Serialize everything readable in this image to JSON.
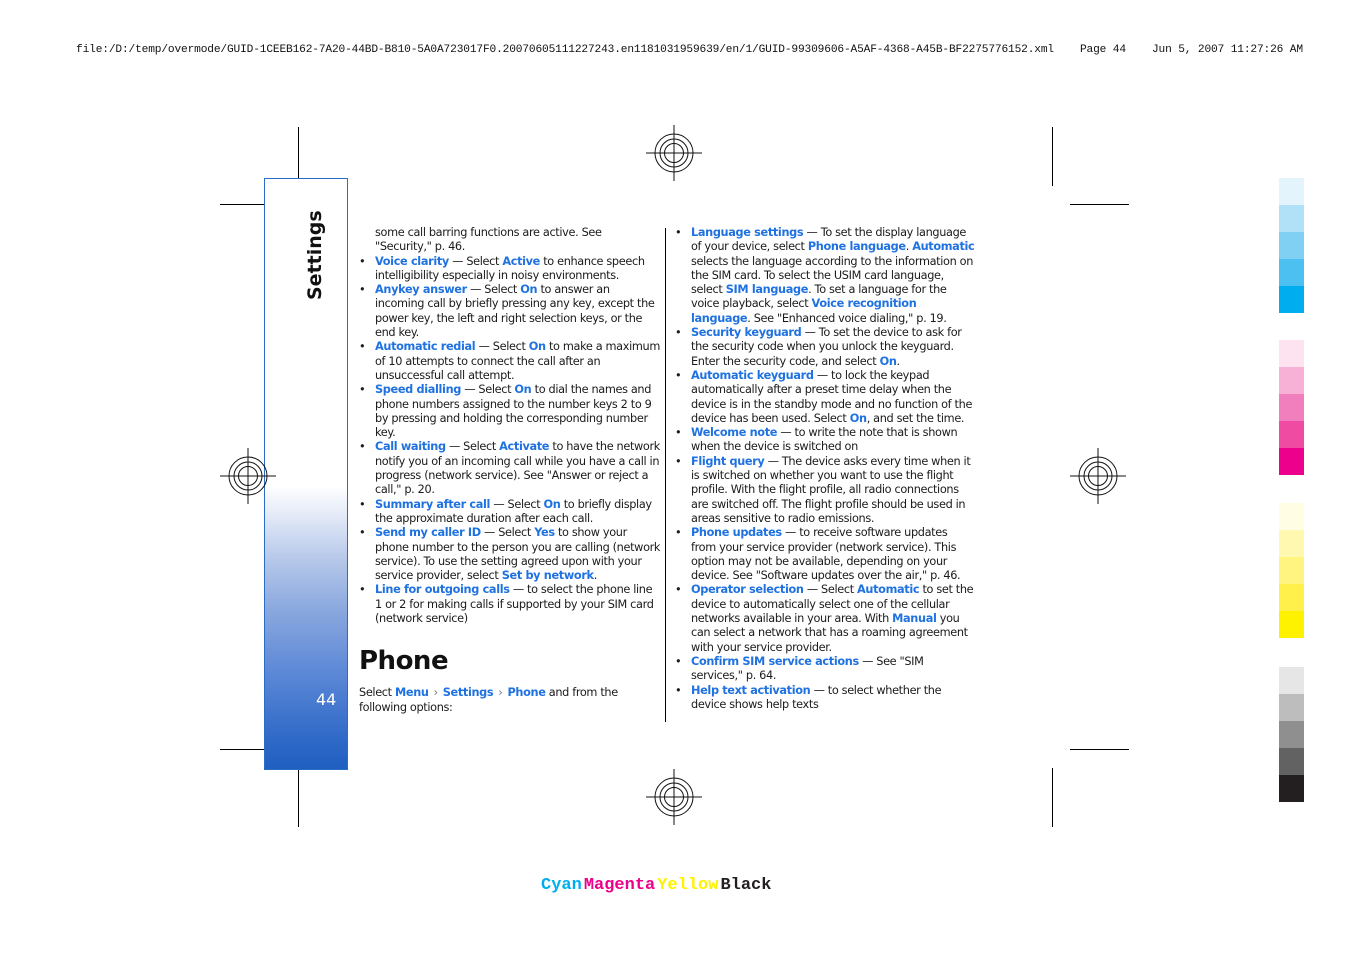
{
  "header": {
    "file_path": "file:/D:/temp/overmode/GUID-1CEEB162-7A20-44BD-B810-5A0A723017F0.20070605111227243.en1181031959639/en/1/GUID-99309606-A5AF-4368-A45B-BF2275776152.xml",
    "page_label": "Page 44",
    "timestamp": "Jun 5, 2007 11:27:26 AM"
  },
  "side_tab": {
    "section": "Settings",
    "page_number": "44"
  },
  "left_column": {
    "intro": "some call barring functions are active. See \"Security,\" p. 46.",
    "items": [
      {
        "term": "Voice clarity",
        "parts": [
          " — Select ",
          {
            "kw": "Active"
          },
          " to enhance speech intelligibility especially in noisy environments."
        ]
      },
      {
        "term": "Anykey answer",
        "parts": [
          " — Select ",
          {
            "kw": "On"
          },
          " to answer an incoming call by briefly pressing any key, except the power key, the left and right selection keys, or the end key."
        ]
      },
      {
        "term": "Automatic redial",
        "parts": [
          " — Select ",
          {
            "kw": "On"
          },
          " to make a maximum of 10 attempts to connect the call after an unsuccessful call attempt."
        ]
      },
      {
        "term": "Speed dialling",
        "parts": [
          " — Select ",
          {
            "kw": "On"
          },
          " to dial the names and phone numbers assigned to the number keys 2 to 9 by pressing and holding the corresponding number key."
        ]
      },
      {
        "term": "Call waiting",
        "parts": [
          " — Select ",
          {
            "kw": "Activate"
          },
          " to have the network notify you of an incoming call while you have a call in progress (network service). See \"Answer or reject a call,\" p. 20."
        ]
      },
      {
        "term": "Summary after call",
        "parts": [
          " — Select ",
          {
            "kw": "On"
          },
          " to briefly display the approximate duration after each call."
        ]
      },
      {
        "term": "Send my caller ID",
        "parts": [
          " — Select ",
          {
            "kw": "Yes"
          },
          " to show your phone number to the person you are calling (network service). To use the setting agreed upon with your service provider, select ",
          {
            "kw": "Set by network"
          },
          "."
        ]
      },
      {
        "term": "Line for outgoing calls",
        "parts": [
          " — to select the phone line 1 or 2 for making calls if supported by your SIM card (network service)"
        ]
      }
    ],
    "section_title": "Phone",
    "path_prefix": "Select ",
    "path": [
      "Menu",
      "Settings",
      "Phone"
    ],
    "path_suffix": " and from the following options:"
  },
  "right_column": {
    "items": [
      {
        "term": "Language settings",
        "parts": [
          " — To set the display language of your device, select ",
          {
            "kw": "Phone language"
          },
          ". ",
          {
            "kw": "Automatic"
          },
          " selects the language according to the information on the SIM card. To select the USIM card language, select ",
          {
            "kw": "SIM language"
          },
          ". To set a language for the voice playback, select ",
          {
            "kw": "Voice recognition language"
          },
          ". See \"Enhanced voice dialing,\" p. 19."
        ]
      },
      {
        "term": "Security keyguard",
        "parts": [
          " — To set the device to ask for the security code when you unlock the keyguard. Enter the security code, and select ",
          {
            "kw": "On"
          },
          "."
        ]
      },
      {
        "term": "Automatic keyguard",
        "parts": [
          " — to lock the keypad automatically after a preset time delay when the device is in the standby mode and no function of the device has been used. Select ",
          {
            "kw": "On"
          },
          ", and set the time."
        ]
      },
      {
        "term": "Welcome note",
        "parts": [
          " — to write the note that is shown when the device is switched on"
        ]
      },
      {
        "term": "Flight query",
        "parts": [
          " — The device asks every time when it is switched on whether you want to use the flight profile. With the flight profile, all radio connections are switched off. The flight profile should be used in areas sensitive to radio emissions."
        ]
      },
      {
        "term": "Phone updates",
        "parts": [
          " — to receive software updates from your service provider (network service). This option may not be available, depending on your device. See \"Software updates over the air,\" p. 46."
        ]
      },
      {
        "term": "Operator selection",
        "parts": [
          " — Select ",
          {
            "kw": "Automatic"
          },
          " to set the device to automatically select one of the cellular networks available in your area. With ",
          {
            "kw": "Manual"
          },
          " you can select a network that has a roaming agreement with your service provider."
        ]
      },
      {
        "term": "Confirm SIM service actions",
        "parts": [
          " — See \"SIM services,\" p. 64."
        ]
      },
      {
        "term": "Help text activation",
        "parts": [
          " — to select whether the device shows help texts"
        ]
      }
    ]
  },
  "colors": {
    "keyword": "#1f72e0",
    "tab_blue": "#2b6cc4",
    "cyan_scale": [
      "#e3f4fc",
      "#b0e1f7",
      "#7fd0f3",
      "#4cc0f0",
      "#00aeef"
    ],
    "magenta_scale": [
      "#fde3ef",
      "#f7b0d6",
      "#f27fbd",
      "#ef4ba3",
      "#ec008c"
    ],
    "yellow_scale": [
      "#fffde3",
      "#fff8b0",
      "#fff47f",
      "#fff04b",
      "#fff200"
    ],
    "black_scale": [
      "#e6e6e6",
      "#bdbdbd",
      "#8f8f8f",
      "#626262",
      "#231f20"
    ]
  },
  "color_labels": [
    {
      "text": "Cyan",
      "color": "#00aeef"
    },
    {
      "text": "Magenta",
      "color": "#ec008c"
    },
    {
      "text": "Yellow",
      "color": "#fff200"
    },
    {
      "text": "Black",
      "color": "#231f20"
    }
  ]
}
